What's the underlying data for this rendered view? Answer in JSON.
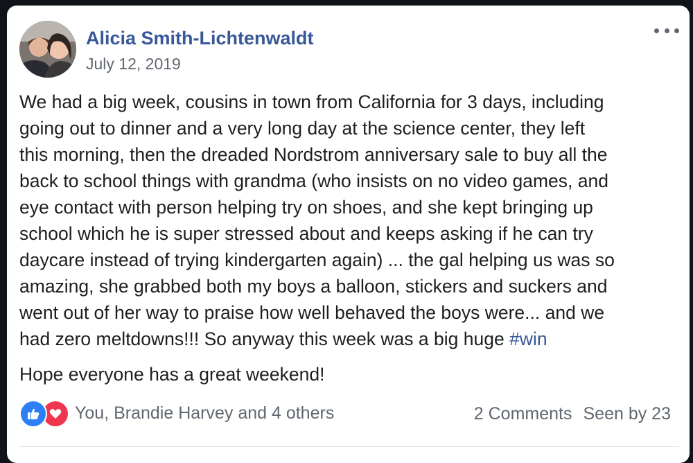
{
  "post": {
    "author": "Alicia Smith-Lichtenwaldt",
    "date": "July 12, 2019",
    "body_lines": [
      "We had a big week, cousins in town from California for 3 days, including",
      "going out to dinner and a very long day at the science center, they left",
      "this morning, then the dreaded Nordstrom anniversary sale to buy all the",
      "back to school things with grandma (who insists on no video games, and",
      "eye contact with person helping try on shoes, and she kept bringing up",
      "school which he is super stressed about and keeps asking if he can try",
      "daycare instead of trying kindergarten again) ... the gal helping us was so",
      "amazing, she grabbed both my boys a balloon, stickers and suckers and",
      "went out of her way to praise how well behaved the boys were... and we"
    ],
    "last_line_prefix": "had zero meltdowns!!! So anyway this week was a big huge ",
    "hashtag": "#win",
    "closing": "Hope everyone has a great weekend!"
  },
  "footer": {
    "reactions_text": "You, Brandie Harvey and 4 others",
    "comments": "2 Comments",
    "seen": "Seen by 23"
  },
  "icons": {
    "more": "more-options-icon",
    "like": "like-icon",
    "love": "love-icon"
  },
  "colors": {
    "link": "#385898",
    "like": "#2d80f4",
    "love": "#f0354e",
    "muted": "#606770"
  }
}
